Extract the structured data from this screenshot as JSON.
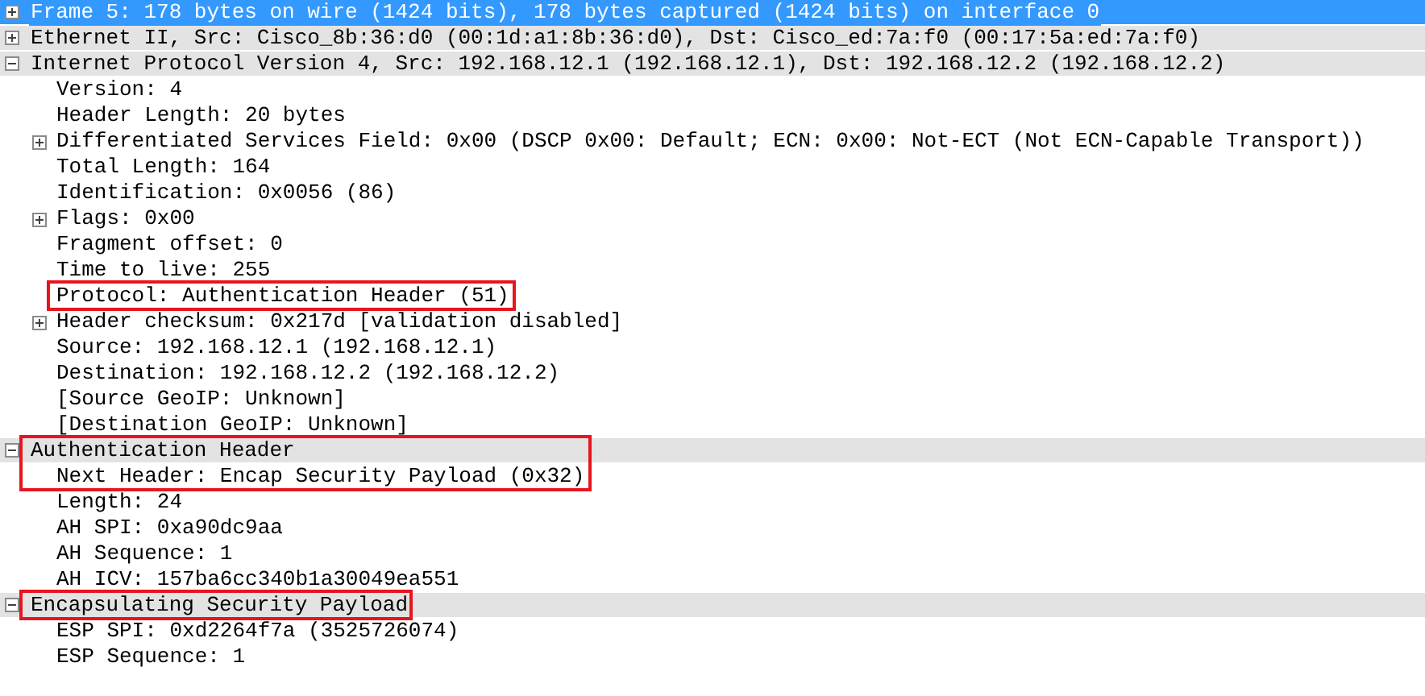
{
  "tree": [
    {
      "label": "Frame 5: 178 bytes on wire (1424 bits), 178 bytes captured (1424 bits) on interface 0",
      "expanded": false,
      "selected": true
    },
    {
      "label": "Ethernet II, Src: Cisco_8b:36:d0 (00:1d:a1:8b:36:d0), Dst: Cisco_ed:7a:f0 (00:17:5a:ed:7a:f0)",
      "expanded": false,
      "selected": false
    },
    {
      "label": "Internet Protocol Version 4, Src: 192.168.12.1 (192.168.12.1), Dst: 192.168.12.2 (192.168.12.2)",
      "expanded": true,
      "selected": false,
      "children": [
        {
          "label": "Version: 4"
        },
        {
          "label": "Header Length: 20 bytes"
        },
        {
          "label": "Differentiated Services Field: 0x00 (DSCP 0x00: Default; ECN: 0x00: Not-ECT (Not ECN-Capable Transport))",
          "expanded": false
        },
        {
          "label": "Total Length: 164"
        },
        {
          "label": "Identification: 0x0056 (86)"
        },
        {
          "label": "Flags: 0x00",
          "expanded": false
        },
        {
          "label": "Fragment offset: 0"
        },
        {
          "label": "Time to live: 255"
        },
        {
          "label": "Protocol: Authentication Header (51)",
          "boxed": true
        },
        {
          "label": "Header checksum: 0x217d [validation disabled]",
          "expanded": false
        },
        {
          "label": "Source: 192.168.12.1 (192.168.12.1)"
        },
        {
          "label": "Destination: 192.168.12.2 (192.168.12.2)"
        },
        {
          "label": "[Source GeoIP: Unknown]"
        },
        {
          "label": "[Destination GeoIP: Unknown]"
        }
      ]
    },
    {
      "label": "Authentication Header",
      "expanded": true,
      "selected": false,
      "boxed": true,
      "children": [
        {
          "label": "Next Header: Encap Security Payload (0x32)",
          "boxed": true
        },
        {
          "label": "Length: 24"
        },
        {
          "label": "AH SPI: 0xa90dc9aa"
        },
        {
          "label": "AH Sequence: 1"
        },
        {
          "label": "AH ICV: 157ba6cc340b1a30049ea551"
        }
      ]
    },
    {
      "label": "Encapsulating Security Payload",
      "expanded": true,
      "selected": false,
      "boxed": true,
      "children": [
        {
          "label": "ESP SPI: 0xd2264f7a (3525726074)"
        },
        {
          "label": "ESP Sequence: 1"
        }
      ]
    }
  ]
}
